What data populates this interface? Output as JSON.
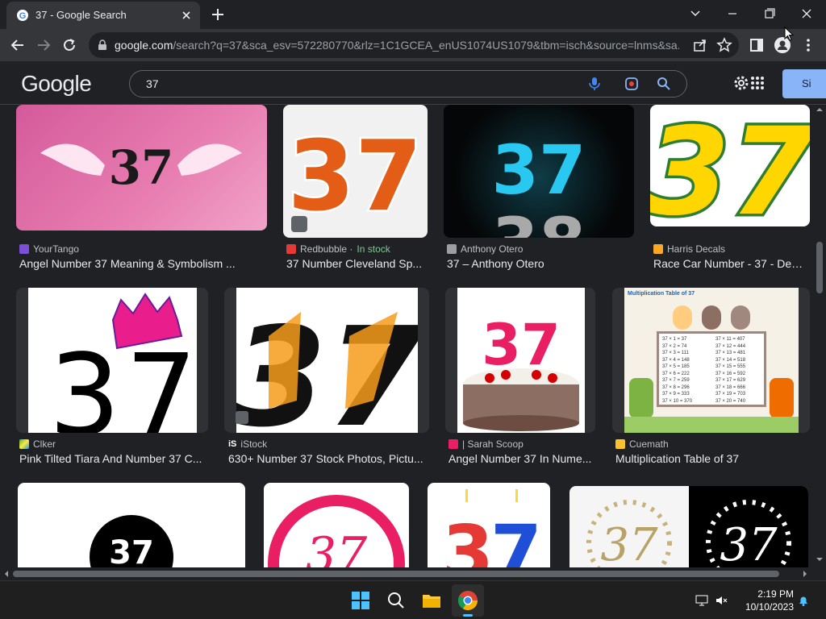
{
  "browser": {
    "tab_title": "37 - Google Search",
    "url_host": "google.com",
    "url_rest": "/search?q=37&sca_esv=572280770&rlz=1C1GCEA_enUS1074US1079&tbm=isch&source=lnms&sa..."
  },
  "google": {
    "logo": "Google",
    "query": "37",
    "signin_label": "Si"
  },
  "results": [
    {
      "source": "YourTango",
      "in_stock": "",
      "caption": "Angel Number 37 Meaning & Symbolism ...",
      "color": "#7b4fd6"
    },
    {
      "source": "Redbubble · ",
      "in_stock": "In stock",
      "caption": "37 Number Cleveland Sp...",
      "color": "#e53935"
    },
    {
      "source": "Anthony Otero",
      "in_stock": "",
      "caption": "37 – Anthony Otero",
      "color": "#9e9e9e"
    },
    {
      "source": "Harris Decals",
      "in_stock": "",
      "caption": "Race Car Number - 37 - Det...",
      "color": "#f9a825"
    },
    {
      "source": "Clker",
      "in_stock": "",
      "caption": "Pink Tilted Tiara And Number 37 C...",
      "color": "#4caf50"
    },
    {
      "source": "iStock",
      "in_stock": "",
      "caption": "630+ Number 37 Stock Photos, Pictu...",
      "color": "#ffffff"
    },
    {
      "source": "| Sarah Scoop",
      "in_stock": "",
      "caption": "Angel Number 37 In Nume...",
      "color": "#e91e63"
    },
    {
      "source": "Cuemath",
      "in_stock": "",
      "caption": "Multiplication Table of 37",
      "color": "#fbc02d"
    }
  ],
  "thumb_text": {
    "number": "37",
    "mult_title": "Multiplication Table of 37",
    "mult_left": [
      "37 × 1 = 37",
      "37 × 2 = 74",
      "37 × 3 = 111",
      "37 × 4 = 148",
      "37 × 5 = 185",
      "37 × 6 = 222",
      "37 × 7 = 259",
      "37 × 8 = 296",
      "37 × 9 = 333",
      "37 × 10 = 370"
    ],
    "mult_right": [
      "37 × 11 = 407",
      "37 × 12 = 444",
      "37 × 13 = 481",
      "37 × 14 = 518",
      "37 × 15 = 555",
      "37 × 16 = 592",
      "37 × 17 = 629",
      "37 × 18 = 666",
      "37 × 19 = 703",
      "37 × 20 = 740"
    ]
  },
  "taskbar": {
    "time": "2:19 PM",
    "date": "10/10/2023"
  },
  "colors": {
    "accent": "#8ab4f8",
    "background": "#202124",
    "in_stock": "#81c995"
  }
}
